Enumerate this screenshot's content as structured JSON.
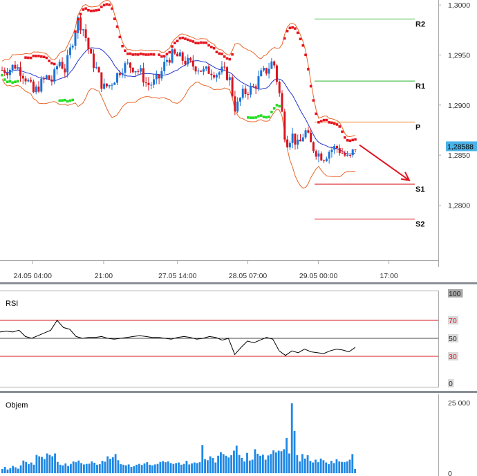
{
  "colors": {
    "up": "#1a73d6",
    "down": "#d9141e",
    "sar": "#e5141e",
    "sar_green": "#22dd22",
    "bollinger": "#e8662a",
    "ma": "#2233cc",
    "pivot_resistance": "#2ab52a",
    "pivot_p": "#f08a2a",
    "pivot_support": "#d9141e",
    "arrow": "#e0141e",
    "volume": "#1e88e5",
    "current_price_bg": "#4ab3e8",
    "grid": "#a8a8a8"
  },
  "chart_data": [
    {
      "type": "candlestick",
      "title": "",
      "ylim": [
        1.2745,
        1.3005
      ],
      "y_tick_labels": [
        "1,3000",
        "1,2950",
        "1,2900",
        "1,2850",
        "1,2800"
      ],
      "y_ticks": [
        1.3,
        1.295,
        1.29,
        1.285,
        1.28
      ],
      "x_tick_labels": [
        "24.05 04:00",
        "21:00",
        "27.05 14:00",
        "28.05 07:00",
        "29.05 00:00",
        "17:00"
      ],
      "current_price": 1.28588,
      "current_price_label": "1,28588",
      "pivots": [
        {
          "name": "R2",
          "value": 1.2986,
          "color_key": "pivot_resistance"
        },
        {
          "name": "R1",
          "value": 1.2924,
          "color_key": "pivot_resistance"
        },
        {
          "name": "P",
          "value": 1.2883,
          "color_key": "pivot_p"
        },
        {
          "name": "S1",
          "value": 1.2821,
          "color_key": "pivot_support"
        },
        {
          "name": "S2",
          "value": 1.2786,
          "color_key": "pivot_support"
        }
      ],
      "projection": {
        "from": 1.2858,
        "to": 1.2822
      },
      "price_path": [
        1.2935,
        1.2935,
        1.294,
        1.2934,
        1.2925,
        1.2912,
        1.292,
        1.2928,
        1.2924,
        1.2945,
        1.2935,
        1.296,
        1.2985,
        1.2975,
        1.2948,
        1.2935,
        1.2917,
        1.292,
        1.2928,
        1.2938,
        1.294,
        1.2937,
        1.2932,
        1.292,
        1.2922,
        1.2928,
        1.2945,
        1.295,
        1.2948,
        1.2944,
        1.294,
        1.2938,
        1.2933,
        1.2935,
        1.2932,
        1.2934,
        1.2928,
        1.2895,
        1.291,
        1.2915,
        1.2918,
        1.293,
        1.2935,
        1.2945,
        1.291,
        1.2862,
        1.287,
        1.2858,
        1.2875,
        1.286,
        1.2852,
        1.2848,
        1.2855,
        1.2858,
        1.2852,
        1.2845,
        1.2858
      ]
    },
    {
      "type": "line",
      "title": "RSI",
      "ylim": [
        0,
        100
      ],
      "y_tick_labels": [
        "100",
        "70",
        "50",
        "30",
        "0"
      ],
      "levels": [
        70,
        50,
        30
      ],
      "values": [
        57,
        58,
        57,
        59,
        52,
        50,
        53,
        56,
        59,
        70,
        62,
        60,
        52,
        50,
        51,
        51,
        52,
        50,
        49,
        50,
        51,
        52,
        53,
        52,
        51,
        51,
        50,
        49,
        51,
        52,
        51,
        49,
        50,
        52,
        51,
        48,
        50,
        32,
        40,
        47,
        45,
        48,
        51,
        49,
        36,
        31,
        36,
        34,
        38,
        35,
        34,
        33,
        36,
        38,
        37,
        35,
        40
      ]
    },
    {
      "type": "bar",
      "title": "Objem",
      "ylim": [
        0,
        26500
      ],
      "y_tick_labels": [
        "25 000",
        "0"
      ],
      "values": [
        1500,
        2200,
        1300,
        1800,
        2600,
        2100,
        1600,
        2800,
        4500,
        4000,
        3200,
        3800,
        3000,
        6500,
        6000,
        5800,
        5000,
        7000,
        6500,
        6000,
        7000,
        4000,
        3000,
        2800,
        3500,
        2600,
        3300,
        4200,
        3900,
        4500,
        3600,
        3100,
        3300,
        3400,
        4200,
        3700,
        3000,
        3200,
        4400,
        4100,
        6000,
        5100,
        5700,
        6800,
        4600,
        3200,
        3000,
        2800,
        3100,
        2200,
        2500,
        3000,
        3300,
        2900,
        3500,
        3900,
        3000,
        2800,
        3100,
        3300,
        4000,
        4300,
        3900,
        4200,
        3600,
        3300,
        3600,
        3800,
        3000,
        3300,
        4400,
        3100,
        3500,
        3800,
        3600,
        3900,
        10000,
        5000,
        4600,
        6000,
        5400,
        3800,
        6200,
        7500,
        6800,
        6200,
        5600,
        6400,
        8000,
        9800,
        6500,
        5400,
        4200,
        7200,
        4500,
        4800,
        8500,
        6900,
        6200,
        6600,
        4800,
        6300,
        6800,
        8100,
        7400,
        8000,
        7800,
        8500,
        12500,
        7000,
        24800,
        15000,
        6400,
        4200,
        6800,
        5200,
        6400,
        4400,
        3800,
        4800,
        3900,
        5200,
        4600,
        3800,
        3200,
        4400,
        3600,
        5000,
        4200,
        4000,
        3900,
        4200,
        4800,
        6800,
        1500
      ]
    }
  ]
}
